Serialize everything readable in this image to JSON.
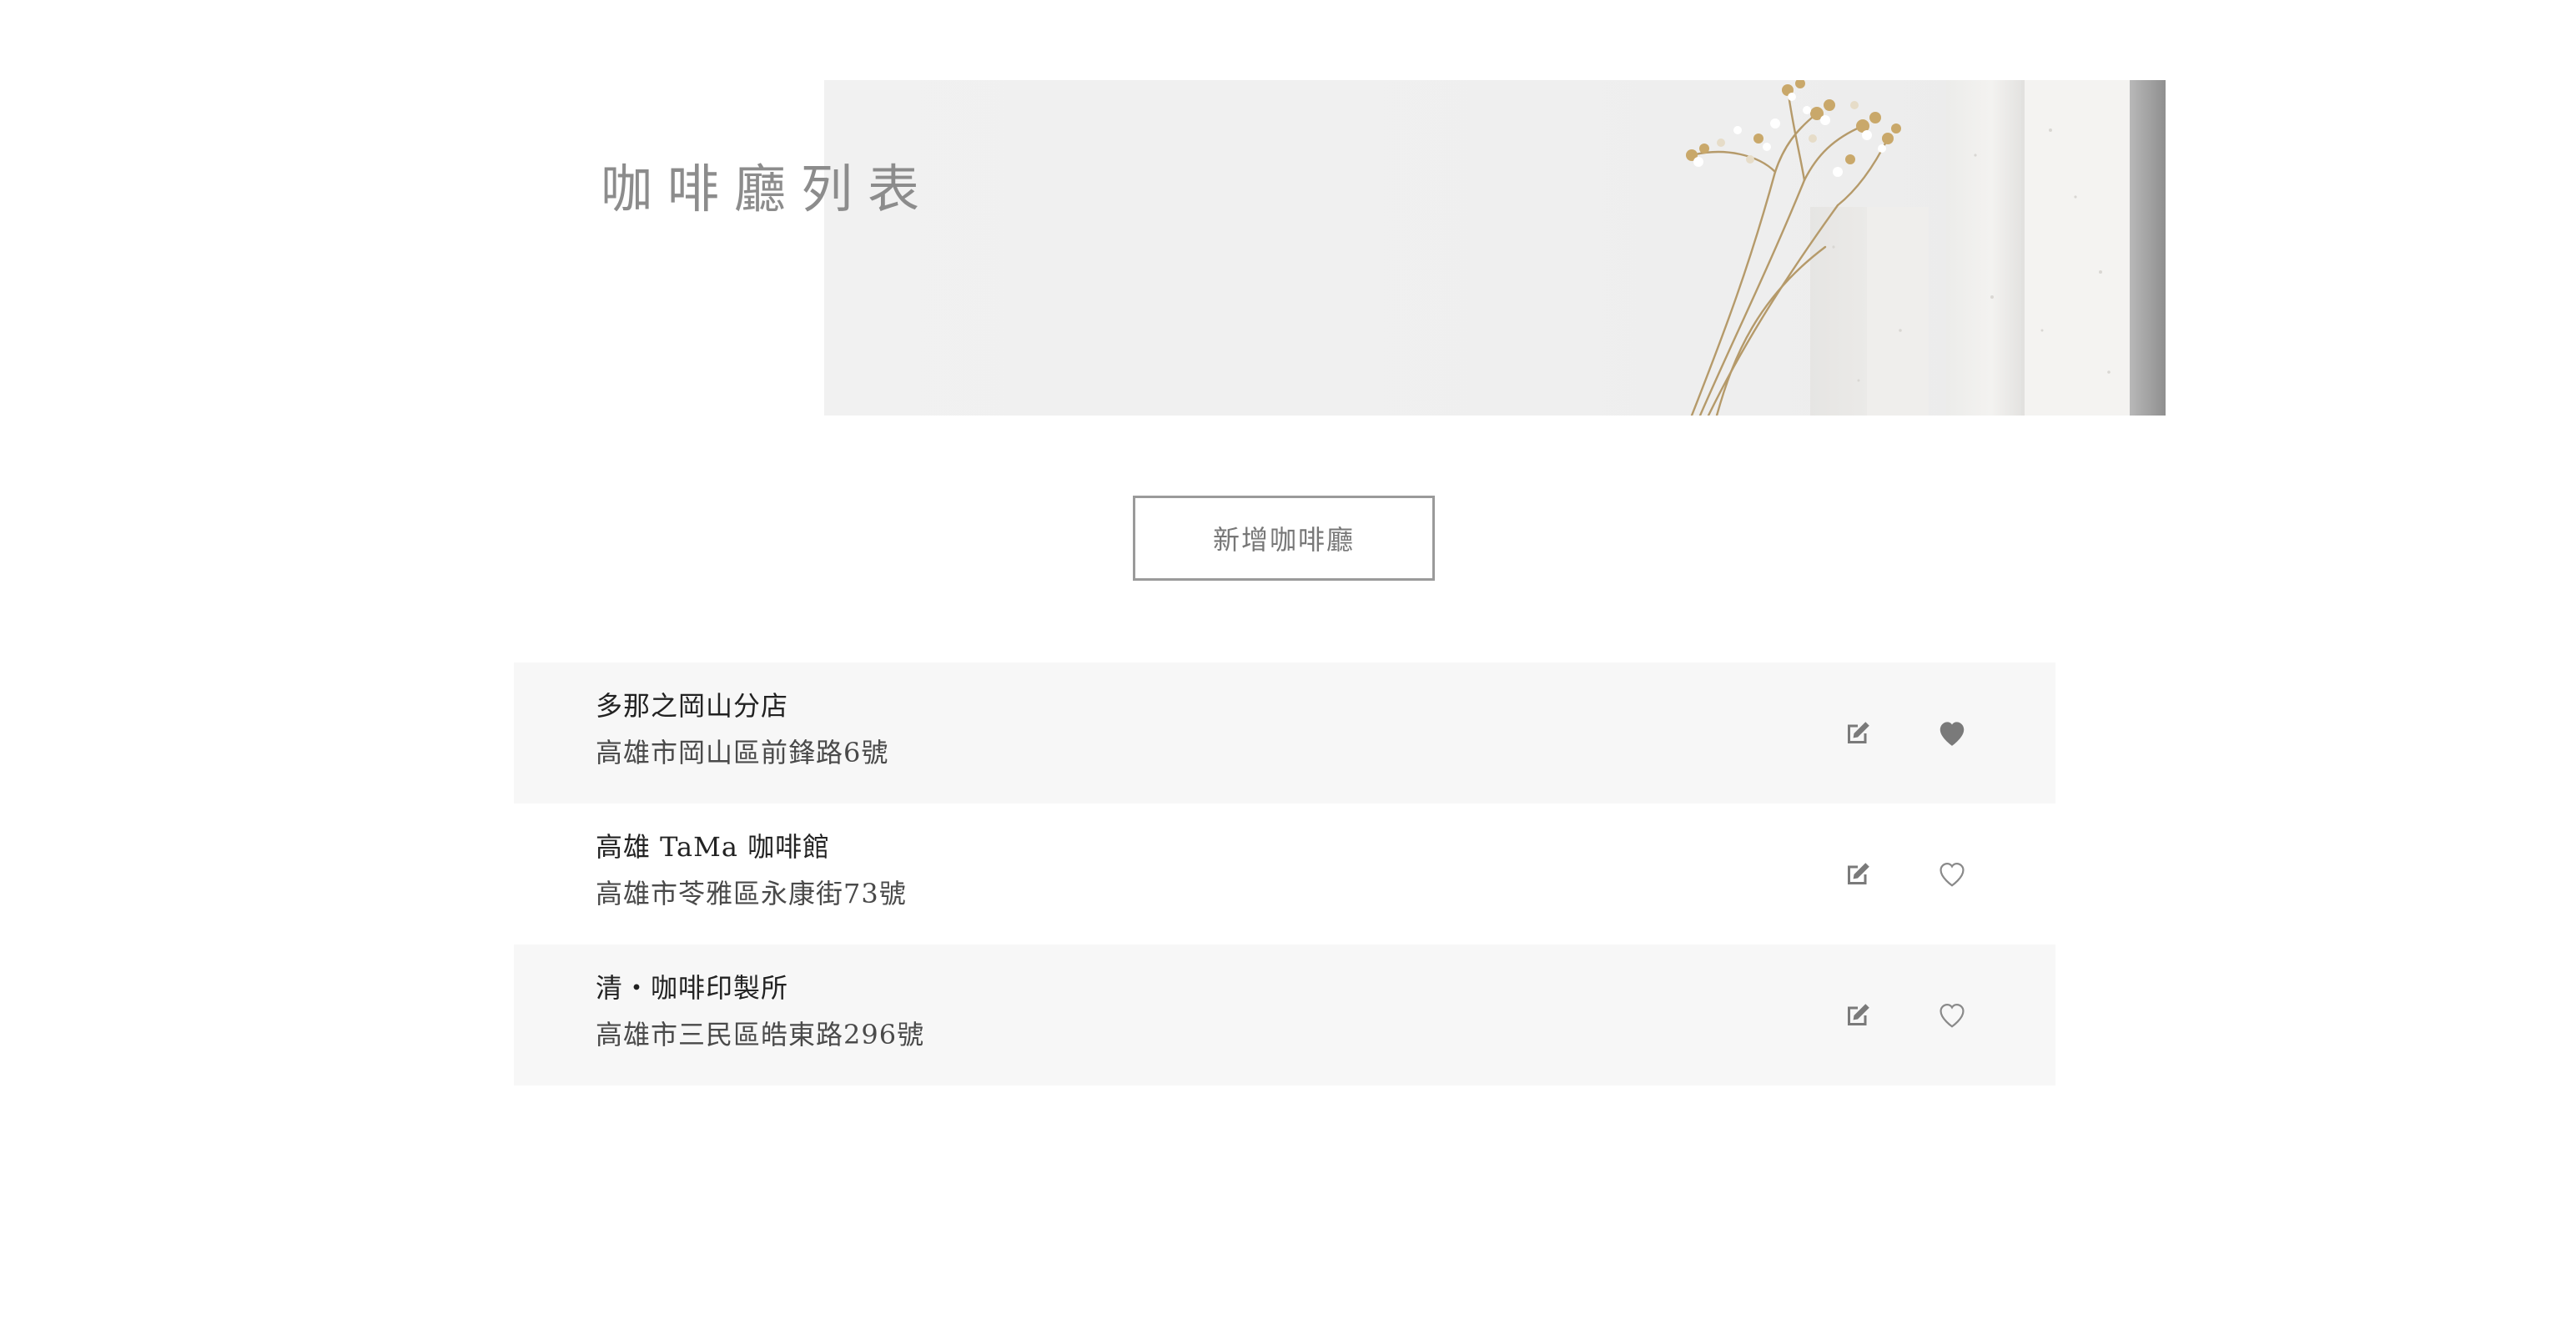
{
  "header": {
    "title": "咖啡廳列表"
  },
  "actions": {
    "add_label": "新增咖啡廳"
  },
  "cafes": [
    {
      "name": "多那之岡山分店",
      "address": "高雄市岡山區前鋒路6號",
      "favorite": true
    },
    {
      "name": "高雄 TaMa 咖啡館",
      "address": "高雄市苓雅區永康街73號",
      "favorite": false
    },
    {
      "name": "清・咖啡印製所",
      "address": "高雄市三民區皓東路296號",
      "favorite": false
    }
  ],
  "icons": {
    "edit": "edit-icon",
    "heart_filled": "heart-filled-icon",
    "heart_outline": "heart-outline-icon"
  },
  "colors": {
    "row_shade": "#f7f7f7",
    "icon": "#7a7a7a",
    "title": "#8c8c8c",
    "button_border": "#9a9a9a"
  }
}
